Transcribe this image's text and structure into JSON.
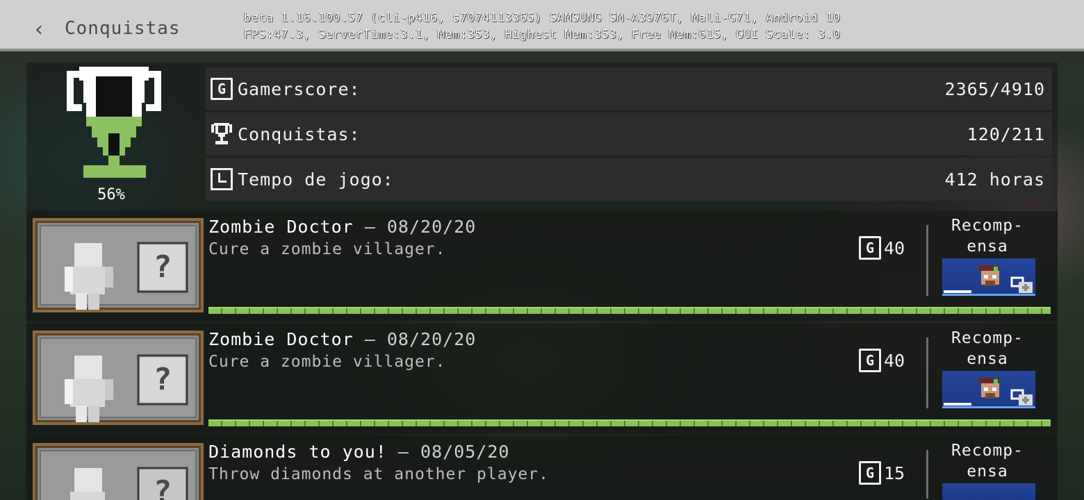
{
  "header": {
    "title": "Conquistas",
    "debug_line1": "beta 1.16.100.57 (cli-p416, s7074113365) SAMSUNG SM-A3976T, Mali-G71, Android 10",
    "debug_line2": "FPS:47.3, ServerTime:3.1, Mem:353, Highest Mem:353, Free Mem:615, GUI Scale: 3.0"
  },
  "summary": {
    "completion_percent": "56%",
    "completion_fraction": 0.56,
    "stats": [
      {
        "icon": "gamerscore-icon",
        "label": "Gamerscore:",
        "value": "2365/4910"
      },
      {
        "icon": "trophy-icon",
        "label": "Conquistas:",
        "value": "120/211"
      },
      {
        "icon": "clock-icon",
        "label": "Tempo de jogo:",
        "value": "412 horas"
      }
    ]
  },
  "achievements": [
    {
      "title": "Zombie Doctor",
      "date": "08/20/20",
      "description": "Cure a zombie villager.",
      "score": "40",
      "reward_label_1": "Recomp-",
      "reward_label_2": "ensa"
    },
    {
      "title": "Zombie Doctor",
      "date": "08/20/20",
      "description": "Cure a zombie villager.",
      "score": "40",
      "reward_label_1": "Recomp-",
      "reward_label_2": "ensa"
    },
    {
      "title": "Diamonds to you!",
      "date": "08/05/20",
      "description": "Throw diamonds at another player.",
      "score": "15",
      "reward_label_1": "Recomp-",
      "reward_label_2": "ensa"
    }
  ],
  "colors": {
    "header_bg": "#d0d0d0",
    "progress_green": "#86c35a",
    "trophy_green": "#8bc160"
  }
}
